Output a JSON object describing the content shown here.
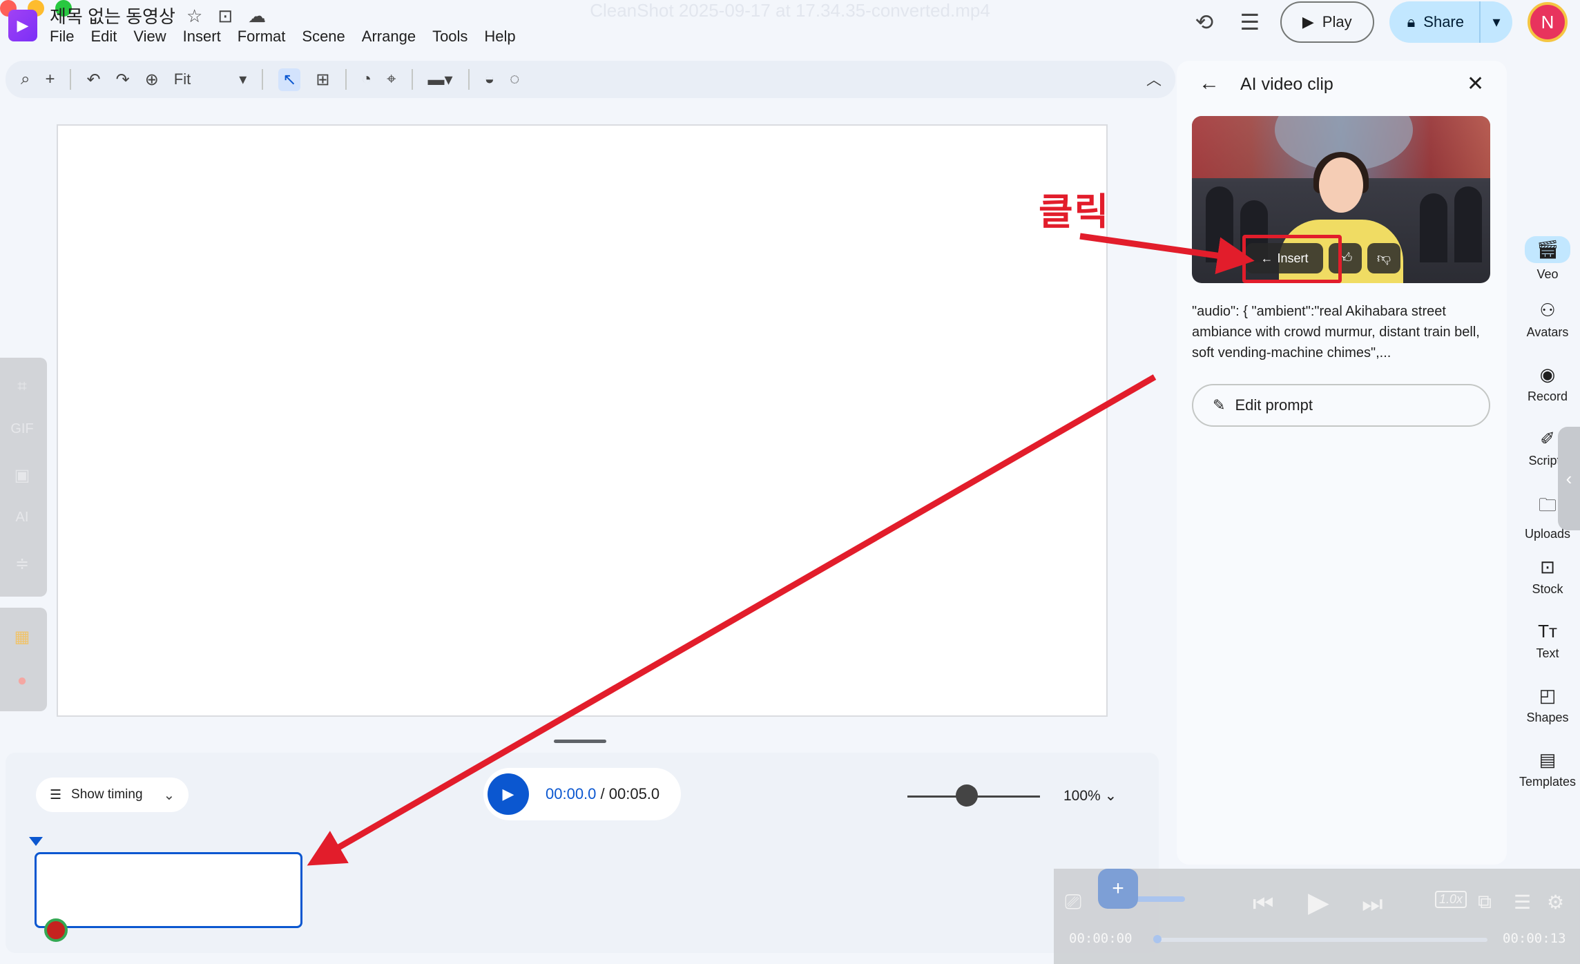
{
  "titlebar": {
    "window_title": "CleanShot 2025-09-17 at 17.34.35-converted.mp4",
    "doc_title": "제목 없는 동영상",
    "icons": [
      "star-icon",
      "move-to-folder-icon",
      "cloud-icon"
    ]
  },
  "menu": [
    "File",
    "Edit",
    "View",
    "Insert",
    "Format",
    "Scene",
    "Arrange",
    "Tools",
    "Help"
  ],
  "header": {
    "play_label": "Play",
    "share_label": "Share",
    "avatar_initial": "N",
    "icons": [
      "history-icon",
      "comments-icon"
    ]
  },
  "toolbar": {
    "zoom_value": "Fit",
    "icons": [
      "search-icon",
      "add-icon",
      "undo-icon",
      "redo-icon",
      "zoom-icon",
      "select-icon",
      "text-box-icon",
      "palette-icon",
      "paint-format-icon",
      "border-style-icon",
      "fill-icon",
      "effect-icon",
      "collapse-icon"
    ]
  },
  "left_rail": {
    "tools_a": [
      "crop-icon",
      "gif-icon",
      "video-icon",
      "ai-icon",
      "adjust-icon"
    ],
    "tools_b": [
      "sheets-icon",
      "pdf-icon"
    ]
  },
  "timeline": {
    "show_timing_label": "Show timing",
    "current_time": "00:00.0",
    "total_time": "/ 00:05.0",
    "zoom_percent": "100%",
    "zoom_slider_level": 0.4
  },
  "side_panel": {
    "title": "AI video clip",
    "insert_label": "Insert",
    "prompt_text": "\"audio\": { \"ambient\":\"real Akihabara street ambiance with crowd murmur, distant train bell, soft vending-machine chimes\",...",
    "edit_prompt_label": "Edit prompt"
  },
  "right_bar": {
    "items": [
      {
        "label": "Veo",
        "icon": "veo-icon",
        "active": true
      },
      {
        "label": "Avatars",
        "icon": "avatars-icon"
      },
      {
        "label": "Record",
        "icon": "record-icon"
      },
      {
        "label": "Scripts",
        "icon": "scripts-icon"
      },
      {
        "label": "Uploads",
        "icon": "uploads-icon"
      },
      {
        "label": "Stock",
        "icon": "stock-icon"
      },
      {
        "label": "Text",
        "icon": "text-icon"
      },
      {
        "label": "Shapes",
        "icon": "shapes-icon"
      },
      {
        "label": "Templates",
        "icon": "templates-icon"
      }
    ]
  },
  "annotation": {
    "label": "클릭",
    "color": "#e21d2b"
  },
  "player_overlay": {
    "time_left": "00:00:00",
    "time_right": "00:00:13",
    "speed": "1.0x",
    "progress": 0
  },
  "colors": {
    "accent": "#0b57d0",
    "share_bg": "#c2e7ff",
    "annotation_red": "#e21d2b",
    "page_bg": "#f3f6fb"
  }
}
